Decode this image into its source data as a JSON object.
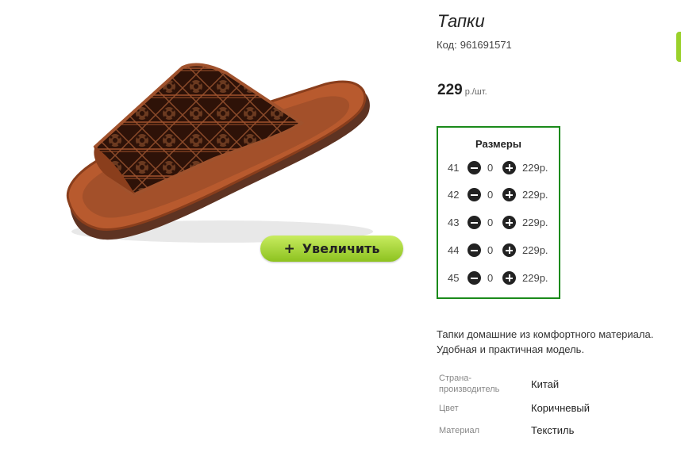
{
  "product": {
    "title": "Тапки",
    "code_label": "Код:",
    "code": "961691571",
    "price": "229",
    "price_unit": "р./шт.",
    "zoom_button": "Увеличить",
    "zoom_button_icon": "plus-icon",
    "image_icon": "slipper-image"
  },
  "sizes": {
    "title": "Размеры",
    "rows": [
      {
        "size": "41",
        "qty": "0",
        "price": "229р."
      },
      {
        "size": "42",
        "qty": "0",
        "price": "229р."
      },
      {
        "size": "43",
        "qty": "0",
        "price": "229р."
      },
      {
        "size": "44",
        "qty": "0",
        "price": "229р."
      },
      {
        "size": "45",
        "qty": "0",
        "price": "229р."
      }
    ]
  },
  "description": {
    "line1": "Тапки домашние из комфортного материала.",
    "line2": "Удобная и практичная модель."
  },
  "attributes": [
    {
      "label": "Страна-производитель",
      "value": "Китай"
    },
    {
      "label": "Цвет",
      "value": "Коричневый"
    },
    {
      "label": "Материал",
      "value": "Текстиль"
    }
  ],
  "colors": {
    "accent_green": "#8dc21f",
    "box_border": "#1a8a1a",
    "slipper_brown": "#3b1d10",
    "sole": "#6b3a26"
  }
}
